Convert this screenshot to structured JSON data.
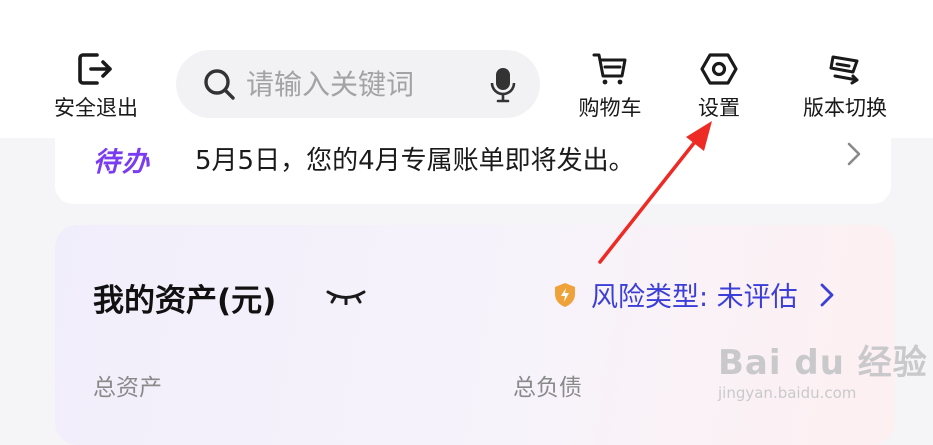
{
  "topbar": {
    "logout_label": "安全退出",
    "search_placeholder": "请输入关键词",
    "cart_label": "购物车",
    "settings_label": "设置",
    "version_label": "版本切换"
  },
  "todo": {
    "badge": "待办",
    "message": "5月5日，您的4月专属账单即将发出。"
  },
  "assets": {
    "title": "我的资产(元)",
    "risk_text": "风险类型: 未评估",
    "total_assets_label": "总资产",
    "total_debt_label": "总负债"
  },
  "watermark": {
    "main": "Bai du 经验",
    "sub": "jingyan.baidu.com"
  },
  "colors": {
    "accent_blue": "#3b3fd8",
    "todo_purple": "#7a3cf0",
    "annotation_red": "#ee2a24",
    "shield_orange": "#f0a23a"
  }
}
